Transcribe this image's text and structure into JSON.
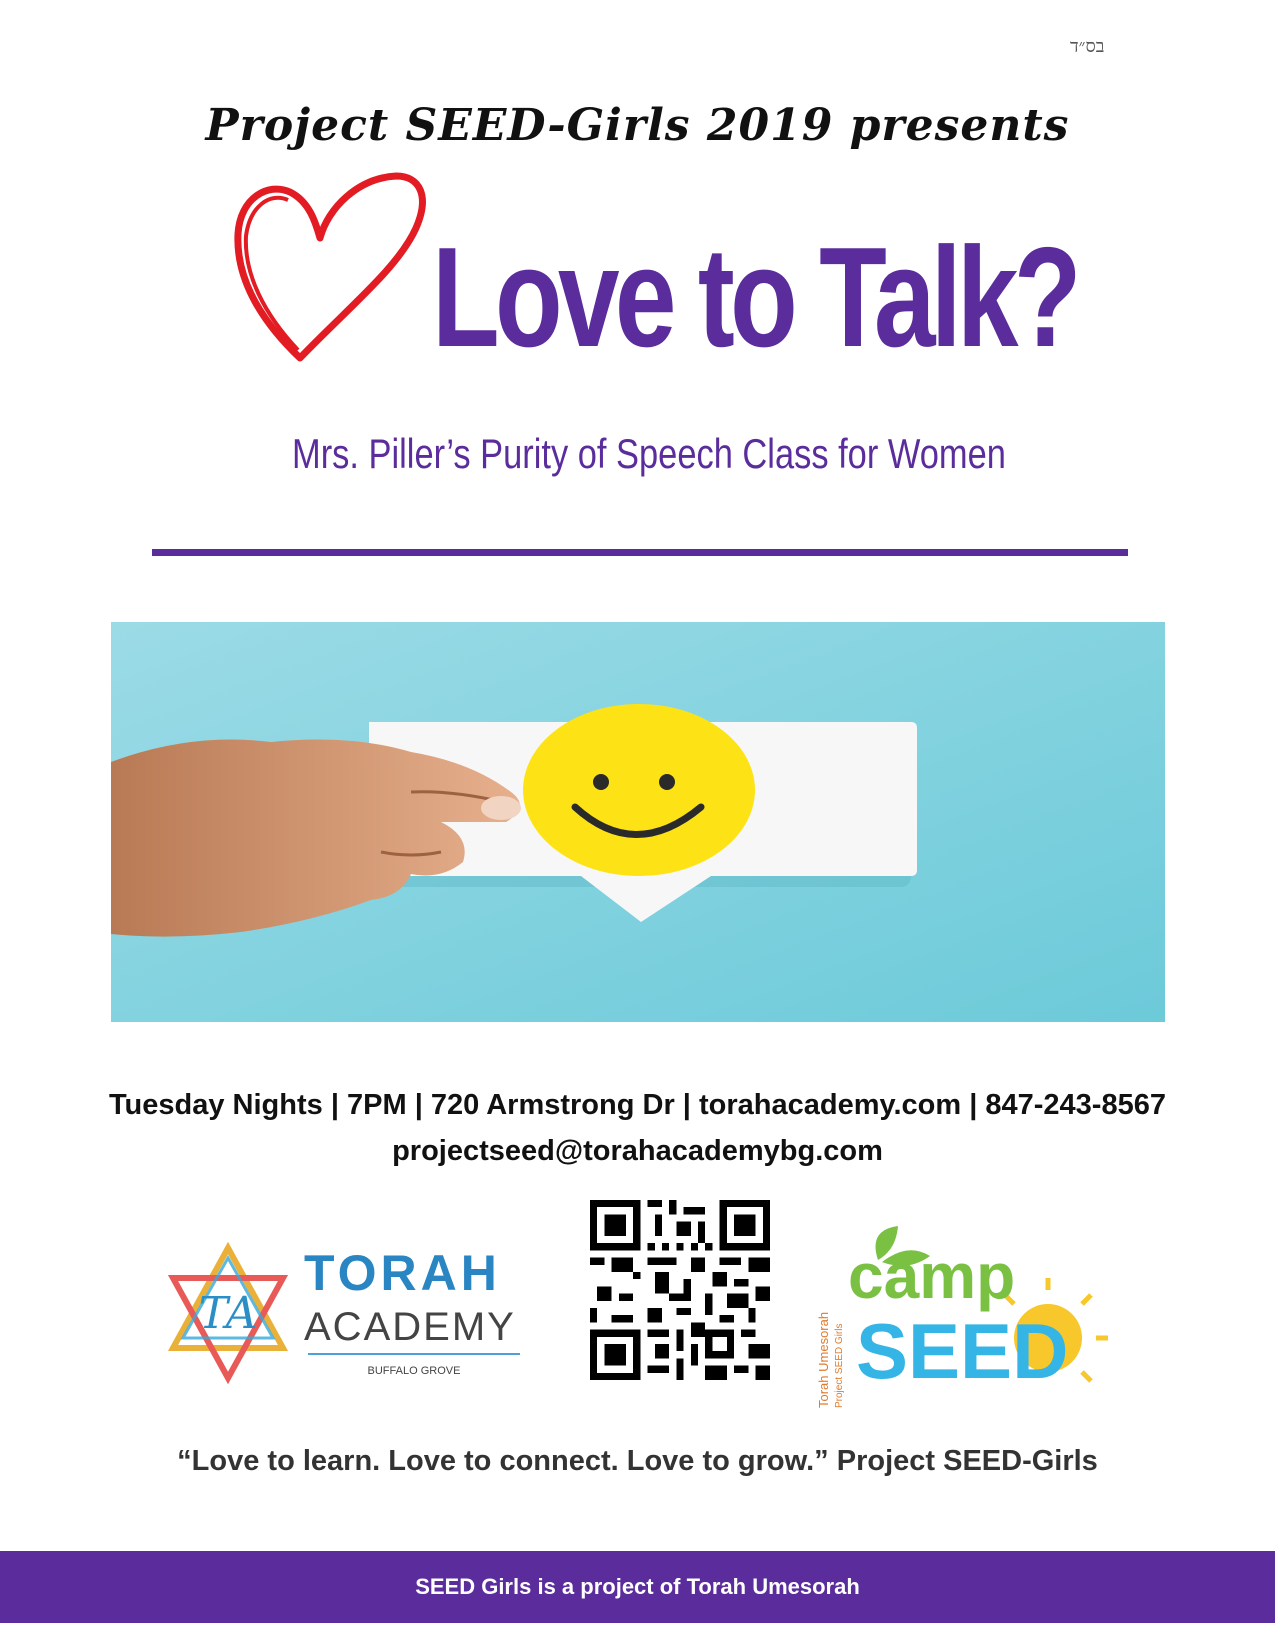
{
  "header": {
    "bsd": "בס״ד",
    "presents": "Project  SEED-Girls 2019 presents",
    "headline": "Love to Talk?",
    "subtitle": "Mrs. Piller’s Purity of Speech Class for Women"
  },
  "details": {
    "line1": "Tuesday Nights | 7PM | 720 Armstrong Dr | torahacademy.com | 847-243-8567",
    "line2": "projectseed@torahacademybg.com"
  },
  "logos": {
    "torah_academy": {
      "monogram": "TA",
      "word1": "TORAH",
      "word2": "ACADEMY",
      "tagline": "BUFFALO GROVE"
    },
    "camp_seed": {
      "camp": "camp",
      "seed": "SEED",
      "side_line1": "Torah Umesorah",
      "side_line2": "Project SEED Girls"
    }
  },
  "quote": "“Love to learn. Love to connect. Love to grow.” Project SEED-Girls",
  "footer": {
    "text": "SEED Girls is a project of Torah Umesorah"
  },
  "colors": {
    "purple": "#5b2d9c",
    "heart_red": "#e31b23",
    "photo_bg": "#86d3e2",
    "smiley_yellow": "#fde315"
  }
}
